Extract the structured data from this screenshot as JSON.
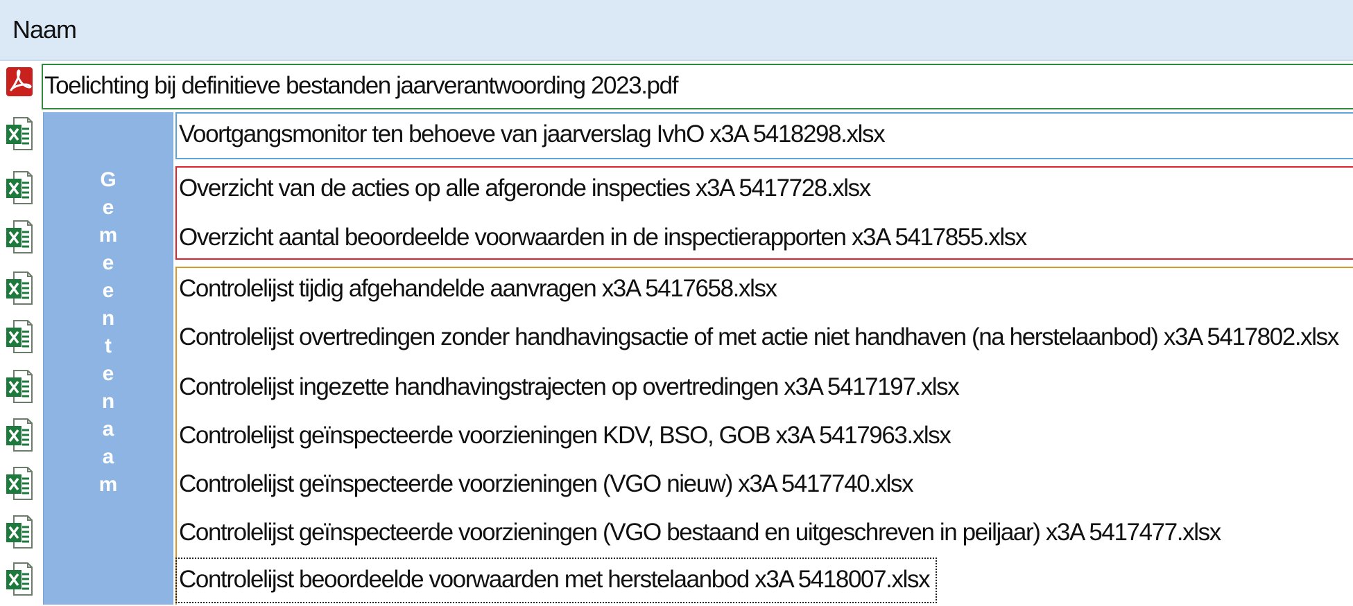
{
  "header": {
    "column_label": "Naam"
  },
  "overlay": {
    "letters": [
      "G",
      "e",
      "m",
      "e",
      "e",
      "n",
      "t",
      "e",
      "n",
      "a",
      "a",
      "m"
    ]
  },
  "files": [
    {
      "name": "Toelichting bij definitieve bestanden jaarverantwoording 2023.pdf",
      "type": "pdf",
      "icon": "pdf-icon"
    },
    {
      "name": "Voortgangsmonitor ten behoeve van jaarverslag IvhO x3A 5418298.xlsx",
      "type": "xlsx",
      "icon": "excel-icon"
    },
    {
      "name": "Overzicht van de acties op alle afgeronde inspecties x3A 5417728.xlsx",
      "type": "xlsx",
      "icon": "excel-icon"
    },
    {
      "name": "Overzicht aantal beoordeelde voorwaarden in de inspectierapporten x3A 5417855.xlsx",
      "type": "xlsx",
      "icon": "excel-icon"
    },
    {
      "name": "Controlelijst tijdig afgehandelde aanvragen x3A 5417658.xlsx",
      "type": "xlsx",
      "icon": "excel-icon"
    },
    {
      "name": "Controlelijst overtredingen zonder handhavingsactie of met actie niet handhaven (na herstelaanbod) x3A 5417802.xlsx",
      "type": "xlsx",
      "icon": "excel-icon"
    },
    {
      "name": "Controlelijst ingezette handhavingstrajecten op overtredingen x3A 5417197.xlsx",
      "type": "xlsx",
      "icon": "excel-icon"
    },
    {
      "name": "Controlelijst geïnspecteerde voorzieningen KDV, BSO, GOB x3A 5417963.xlsx",
      "type": "xlsx",
      "icon": "excel-icon"
    },
    {
      "name": "Controlelijst geïnspecteerde voorzieningen (VGO nieuw) x3A 5417740.xlsx",
      "type": "xlsx",
      "icon": "excel-icon"
    },
    {
      "name": "Controlelijst geïnspecteerde voorzieningen (VGO bestaand en uitgeschreven in peiljaar) x3A 5417477.xlsx",
      "type": "xlsx",
      "icon": "excel-icon"
    },
    {
      "name": "Controlelijst beoordeelde voorwaarden met herstelaanbod x3A 5418007.xlsx",
      "type": "xlsx",
      "icon": "excel-icon"
    }
  ],
  "colors": {
    "header_bg": "#dbe8f6",
    "overlay_bg": "#8db4e2",
    "frame_green": "#2e8b3c",
    "frame_blue": "#5aa6dc",
    "frame_red": "#e0202a",
    "frame_orange": "#d89a2a",
    "pdf_red": "#c8211e",
    "excel_green": "#1d7a3c"
  }
}
